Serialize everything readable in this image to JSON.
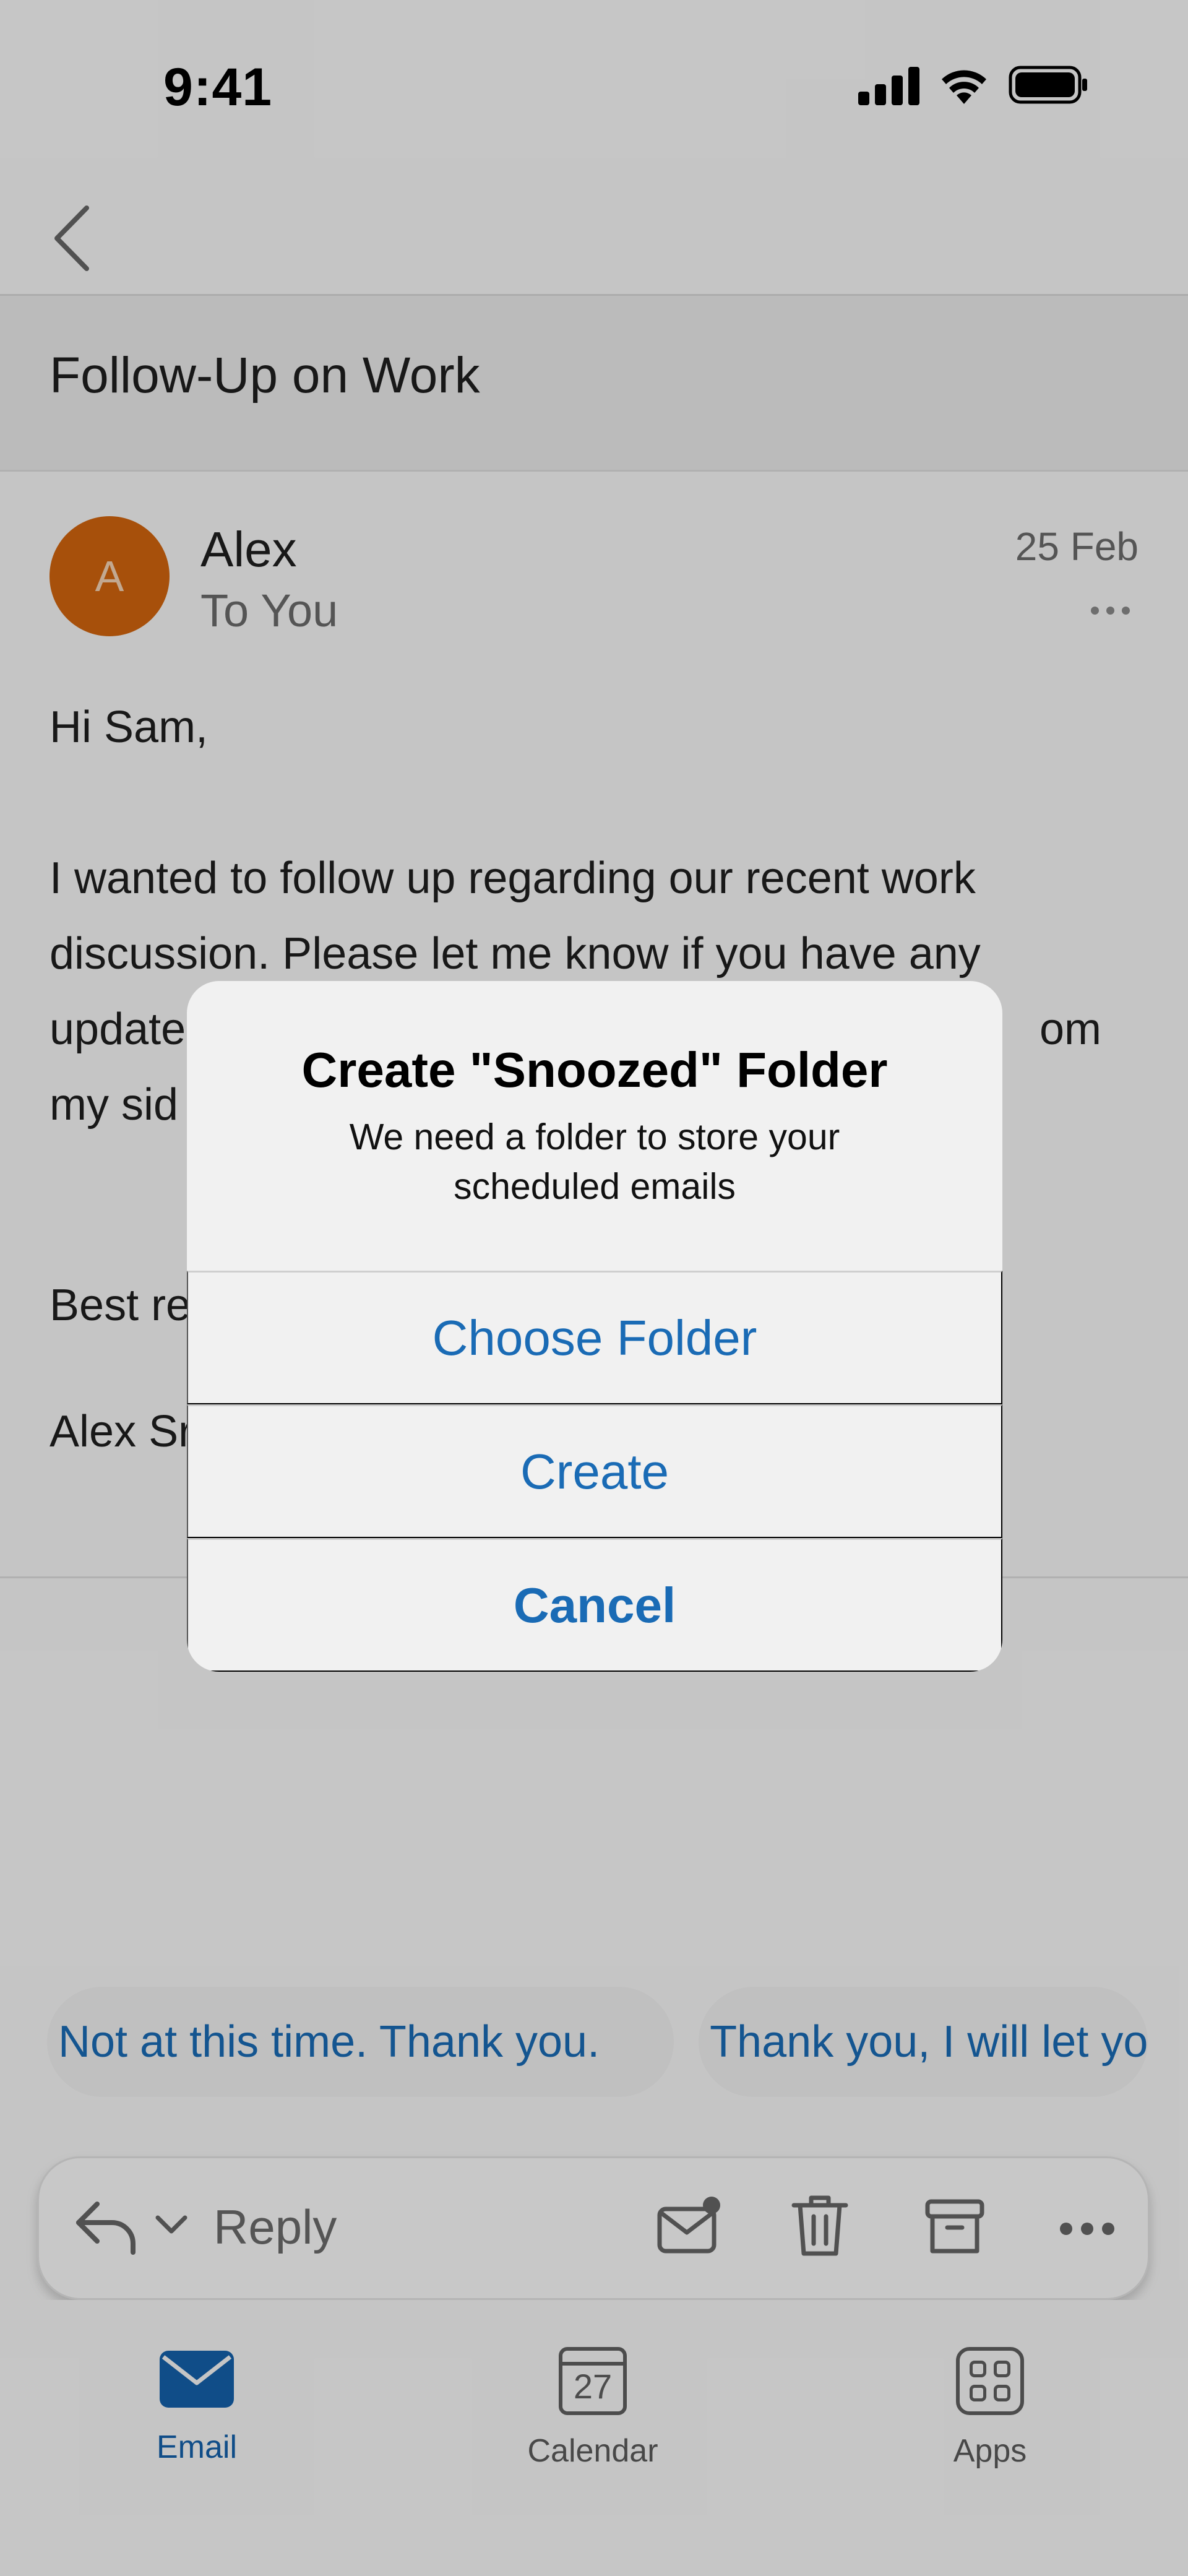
{
  "status_bar": {
    "time": "9:41"
  },
  "subject": {
    "title": "Follow-Up on Work"
  },
  "email": {
    "avatar_initial": "A",
    "sender": "Alex",
    "recipient": "To You",
    "date": "25 Feb",
    "body_lines": [
      "Hi Sam,",
      "I wanted to follow up regarding our recent work",
      "discussion. Please let me know if you have any",
      "update",
      "om",
      "my sid",
      "Best re",
      "Alex Sr"
    ]
  },
  "quick_replies": [
    "Not at this time. Thank you.",
    "Thank you, I will let yo"
  ],
  "reply_bar": {
    "reply_label": "Reply"
  },
  "tab_bar": {
    "tabs": [
      {
        "label": "Email",
        "active": true
      },
      {
        "label": "Calendar",
        "active": false,
        "date": "27"
      },
      {
        "label": "Apps",
        "active": false
      }
    ]
  },
  "alert": {
    "title": "Create \"Snoozed\" Folder",
    "message_line1": "We need a folder to store your",
    "message_line2": "scheduled emails",
    "buttons": [
      "Choose Folder",
      "Create",
      "Cancel"
    ]
  },
  "colors": {
    "accent": "#1a6bb5",
    "avatar": "#d1650e",
    "tab_active": "#1561aa"
  }
}
